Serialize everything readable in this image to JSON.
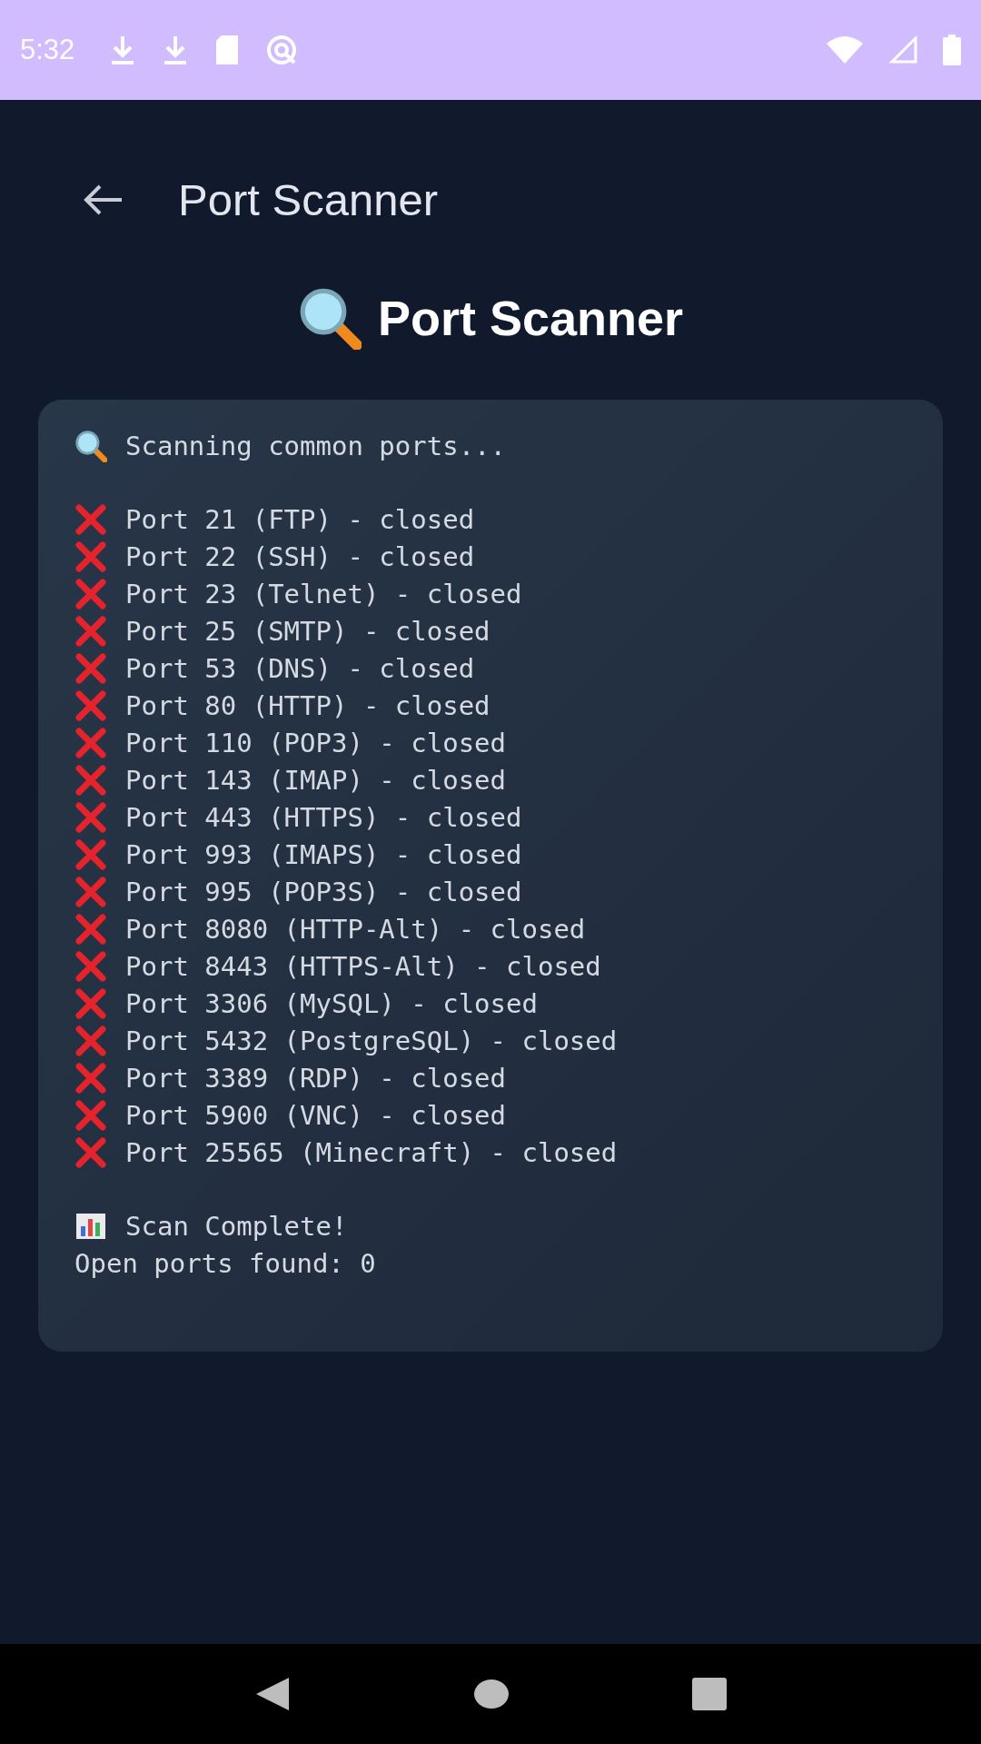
{
  "status_bar": {
    "time": "5:32"
  },
  "toolbar": {
    "title": "Port Scanner"
  },
  "heading": {
    "text": "Port Scanner"
  },
  "card": {
    "sections": [
      {
        "lines": [
          {
            "kind": "scan",
            "text": "Scanning common ports..."
          }
        ]
      },
      {
        "lines": [
          {
            "kind": "closed",
            "text": "Port 21 (FTP) - closed"
          },
          {
            "kind": "closed",
            "text": "Port 22 (SSH) - closed"
          },
          {
            "kind": "closed",
            "text": "Port 23 (Telnet) - closed"
          },
          {
            "kind": "closed",
            "text": "Port 25 (SMTP) - closed"
          },
          {
            "kind": "closed",
            "text": "Port 53 (DNS) - closed"
          },
          {
            "kind": "closed",
            "text": "Port 80 (HTTP) - closed"
          },
          {
            "kind": "closed",
            "text": "Port 110 (POP3) - closed"
          },
          {
            "kind": "closed",
            "text": "Port 143 (IMAP) - closed"
          },
          {
            "kind": "closed",
            "text": "Port 443 (HTTPS) - closed"
          },
          {
            "kind": "closed",
            "text": "Port 993 (IMAPS) - closed"
          },
          {
            "kind": "closed",
            "text": "Port 995 (POP3S) - closed"
          },
          {
            "kind": "closed",
            "text": "Port 8080 (HTTP-Alt) - closed"
          },
          {
            "kind": "closed",
            "text": "Port 8443 (HTTPS-Alt) - closed"
          },
          {
            "kind": "closed",
            "text": "Port 3306 (MySQL) - closed"
          },
          {
            "kind": "closed",
            "text": "Port 5432 (PostgreSQL) - closed"
          },
          {
            "kind": "closed",
            "text": "Port 3389 (RDP) - closed"
          },
          {
            "kind": "closed",
            "text": "Port 5900 (VNC) - closed"
          },
          {
            "kind": "closed",
            "text": "Port 25565 (Minecraft) - closed"
          }
        ]
      },
      {
        "lines": [
          {
            "kind": "complete",
            "text": "Scan Complete!"
          },
          {
            "kind": "plain",
            "text": "Open ports found: 0"
          }
        ]
      }
    ]
  }
}
